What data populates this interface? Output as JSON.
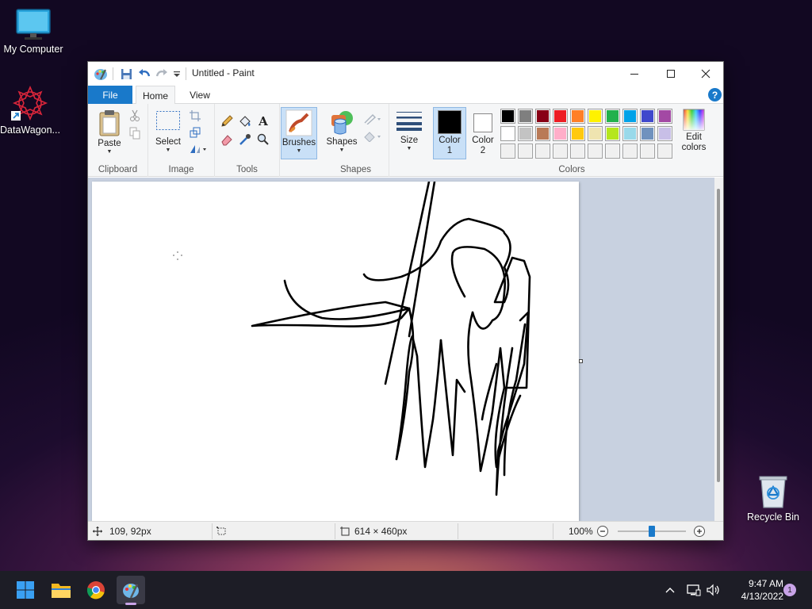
{
  "desktop": {
    "icons": [
      {
        "label": "My Computer",
        "icon": "monitor-icon"
      },
      {
        "label": "DataWagon...",
        "icon": "datawagon-logo-icon"
      },
      {
        "label": "Recycle Bin",
        "icon": "recycle-bin-icon"
      }
    ]
  },
  "window": {
    "title": "Untitled - Paint",
    "tabs": [
      "File",
      "Home",
      "View"
    ],
    "help_label": "?"
  },
  "ribbon": {
    "clipboard": {
      "paste_label": "Paste",
      "group_label": "Clipboard"
    },
    "image": {
      "select_label": "Select",
      "group_label": "Image"
    },
    "tools": {
      "group_label": "Tools",
      "text_tool_glyph": "A"
    },
    "brushes": {
      "label": "Brushes"
    },
    "shapes": {
      "label": "Shapes",
      "group_label": "Shapes"
    },
    "size": {
      "label": "Size"
    },
    "colors": {
      "color1_label": "Color",
      "color1_num": "1",
      "color2_label": "Color",
      "color2_num": "2",
      "color1_value": "#000000",
      "color2_value": "#ffffff",
      "edit_label_1": "Edit",
      "edit_label_2": "colors",
      "group_label": "Colors",
      "palette_row1": [
        "#000000",
        "#7f7f7f",
        "#880015",
        "#ed1c24",
        "#ff7f27",
        "#fff200",
        "#22b14c",
        "#00a2e8",
        "#3f48cc",
        "#a349a4"
      ],
      "palette_row2": [
        "#ffffff",
        "#c3c3c3",
        "#b97a57",
        "#ffaec9",
        "#ffc90e",
        "#efe4b0",
        "#b5e61d",
        "#99d9ea",
        "#7092be",
        "#c8bfe7"
      ],
      "palette_row3": [
        "#f0f0f0",
        "#f0f0f0",
        "#f0f0f0",
        "#f0f0f0",
        "#f0f0f0",
        "#f0f0f0",
        "#f0f0f0",
        "#f0f0f0",
        "#f0f0f0",
        "#f0f0f0"
      ]
    }
  },
  "status": {
    "cursor_pos": "109, 92px",
    "image_size": "614 × 460px",
    "zoom": "100%",
    "zoom_level_fraction": 0.5
  },
  "taskbar": {
    "apps": [
      "start-icon",
      "file-explorer-icon",
      "chrome-icon",
      "paint-icon"
    ],
    "time": "9:47 AM",
    "date": "4/13/2022",
    "notification_count": "1"
  },
  "accent_color": "#1979ca"
}
